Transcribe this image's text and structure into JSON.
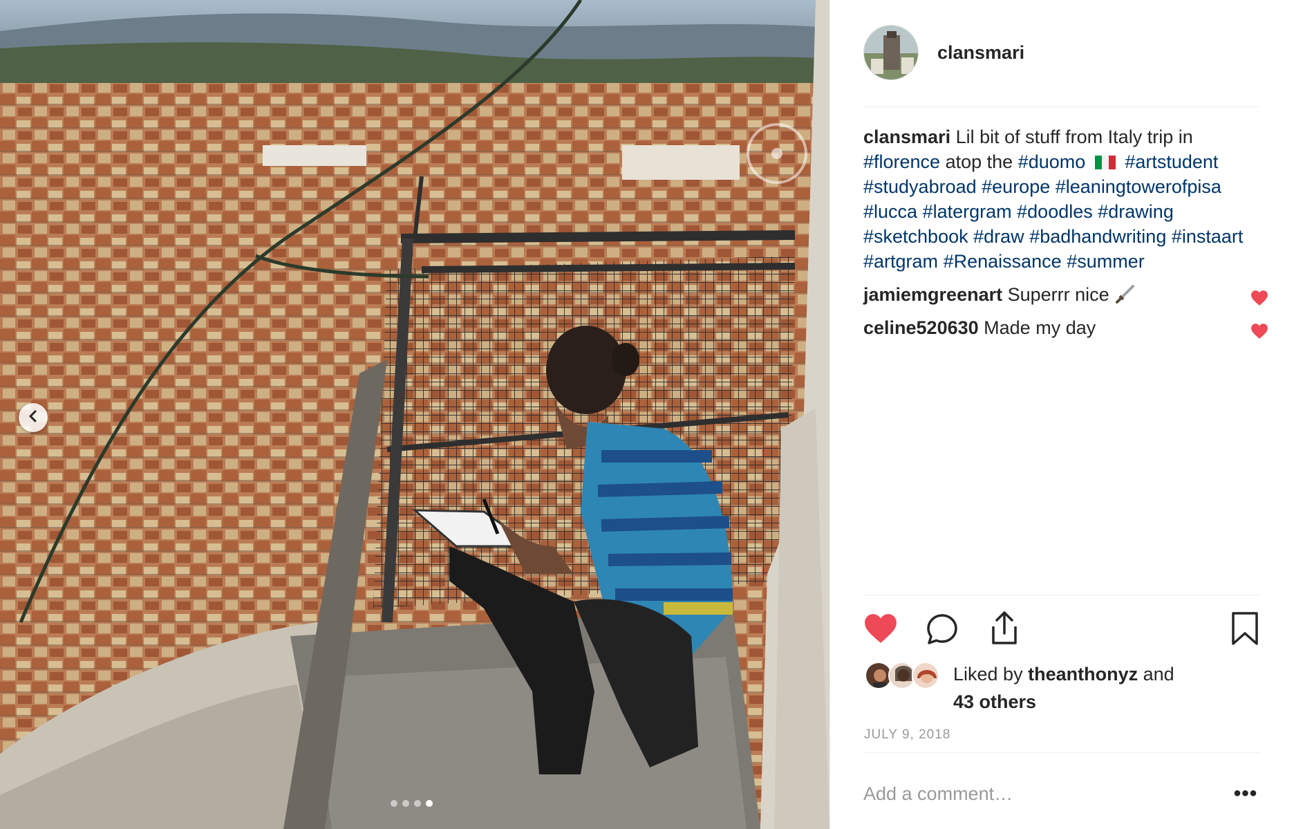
{
  "post": {
    "username": "clansmari",
    "avatar_icon": "profile-avatar",
    "carousel": {
      "total": 4,
      "active_index": 3
    },
    "caption": {
      "username": "clansmari",
      "text_start": "Lil bit of stuff from Italy trip in",
      "tag_florence": "#florence",
      "text_mid": "atop the",
      "tag_duomo": "#duomo",
      "flag_icon": "italy-flag-icon",
      "tags_rest": [
        "#artstudent",
        "#studyabroad",
        "#europe",
        "#leaningtowerofpisa",
        "#lucca",
        "#latergram",
        "#doodles",
        "#drawing",
        "#sketchbook",
        "#draw",
        "#badhandwriting",
        "#instaart",
        "#artgram",
        "#Renaissance",
        "#summer"
      ]
    },
    "comments": [
      {
        "username": "jamiemgreenart",
        "text": "Superrr nice",
        "emoji_icon": "dagger-icon"
      },
      {
        "username": "celine520630",
        "text": "Made my day"
      }
    ],
    "likes": {
      "prefix": "Liked by",
      "user": "theanthonyz",
      "conjunction": "and",
      "others": "43 others"
    },
    "date": "JULY 9, 2018",
    "comment_placeholder": "Add a comment…",
    "more_label": "•••",
    "colors": {
      "heart_red": "#ed4956",
      "hashtag_blue": "#003569",
      "text": "#262626",
      "muted": "#999999"
    }
  }
}
